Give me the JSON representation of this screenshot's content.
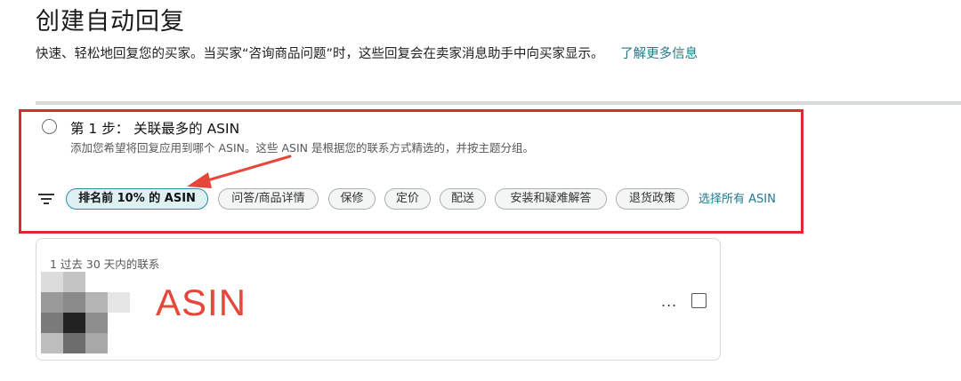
{
  "header": {
    "title": "创建自动回复",
    "subtitle": "快速、轻松地回复您的买家。当买家“咨询商品问题”时，这些回复会在卖家消息助手中向买家显示。",
    "learn_more": "了解更多信息"
  },
  "step": {
    "title": "第 1 步： 关联最多的 ASIN",
    "description": "添加您希望将回复应用到哪个 ASIN。这些 ASIN 是根据您的联系方式精选的，并按主题分组。"
  },
  "filters": {
    "chips": [
      {
        "label": "排名前 10% 的 ASIN",
        "active": true
      },
      {
        "label": "问答/商品详情",
        "active": false
      },
      {
        "label": "保修",
        "active": false
      },
      {
        "label": "定价",
        "active": false
      },
      {
        "label": "配送",
        "active": false
      },
      {
        "label": "安装和疑难解答",
        "active": false
      },
      {
        "label": "退货政策",
        "active": false
      }
    ],
    "select_all": "选择所有 ASIN"
  },
  "asin_card": {
    "contact_count": "1 过去 30 天内的联系",
    "asin": "ASIN",
    "more": "...",
    "checked": false
  },
  "colors": {
    "highlight": "#e4282f",
    "link": "#1f7a8c",
    "asin_text": "#e5473b",
    "active_chip_border": "#2b8ea3"
  },
  "icons": {
    "radio": "radio-icon",
    "filter": "filter-icon",
    "more": "more-options-icon",
    "arrow": "annotation-arrow-icon"
  }
}
